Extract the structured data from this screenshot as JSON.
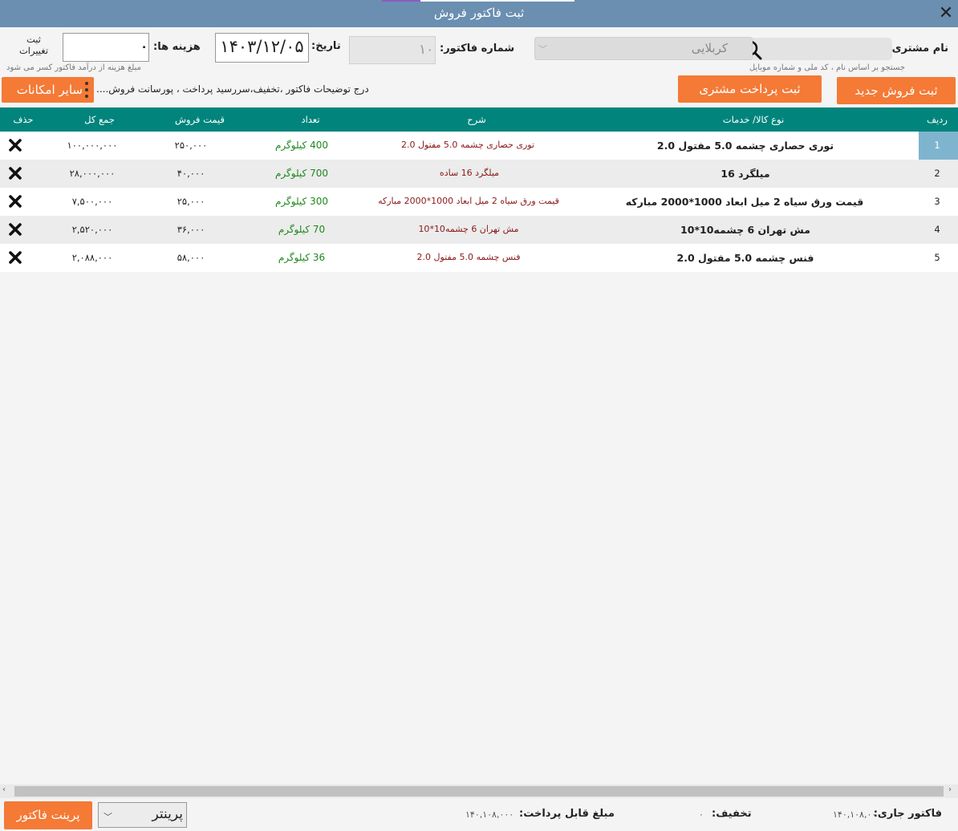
{
  "window": {
    "title": "ثبت فاکتور فروش"
  },
  "header": {
    "customer_label": "نام مشتری:",
    "search_placeholder": "",
    "search_hint": "جستجو بر اساس نام ، کد ملی و شماره موبایل",
    "customer_value": "کربلایی",
    "invoice_number_label": "شماره فاکتور:",
    "invoice_number": "۱۰",
    "date_label": "تاریخ:",
    "date": "۱۴۰۳/۱۲/۰۵",
    "expense_label": "هزینه ها:",
    "expense_value": "۰",
    "expense_hint": "مبلغ هزینه از درآمد فاکتور کسر می شود",
    "save_changes_line1": "ثبت",
    "save_changes_line2": "تغییرات"
  },
  "actions": {
    "new_sale": "ثبت فروش جدید",
    "customer_payment": "ثبت پرداخت مشتری",
    "notes": "درج توضیحات فاکتور ،تخفیف،سررسید پرداخت ، پورسانت فروش....",
    "more_options": "سایر امکانات"
  },
  "table": {
    "columns": {
      "index": "ردیف",
      "product": "نوع کالا/ خدمات",
      "description": "شرح",
      "quantity": "تعداد",
      "unit_price": "قیمت فروش",
      "total": "جمع کل",
      "delete": "حذف"
    },
    "rows": [
      {
        "index": "1",
        "product": "توری حصاری چشمه 5.0 مفتول 2.0",
        "description": "توری حصاری چشمه 5.0 مفتول 2.0",
        "quantity": "400 کیلوگرم",
        "unit_price": "۲۵۰,۰۰۰",
        "total": "۱۰۰,۰۰۰,۰۰۰"
      },
      {
        "index": "2",
        "product": "میلگرد 16",
        "description": "میلگرد 16 ساده",
        "quantity": "700 کیلوگرم",
        "unit_price": "۴۰,۰۰۰",
        "total": "۲۸,۰۰۰,۰۰۰"
      },
      {
        "index": "3",
        "product": "قیمت ورق سیاه 2 میل ابعاد 1000*2000 مبارکه",
        "description": "قیمت ورق سیاه 2 میل ابعاد 1000*2000 مبارکه",
        "quantity": "300 کیلوگرم",
        "unit_price": "۲۵,۰۰۰",
        "total": "۷,۵۰۰,۰۰۰"
      },
      {
        "index": "4",
        "product": "مش تهران 6  چشمه10*10",
        "description": "مش تهران 6  چشمه10*10",
        "quantity": "70 کیلوگرم",
        "unit_price": "۳۶,۰۰۰",
        "total": "۲,۵۲۰,۰۰۰"
      },
      {
        "index": "5",
        "product": "فنس چشمه 5.0 مفتول 2.0",
        "description": "فنس چشمه 5.0 مفتول 2.0",
        "quantity": "36 کیلوگرم",
        "unit_price": "۵۸,۰۰۰",
        "total": "۲,۰۸۸,۰۰۰"
      }
    ]
  },
  "footer": {
    "current_invoice_label": "فاکتور جاری:",
    "current_invoice_value": "۱۴۰,۱۰۸,۰۰۰",
    "discount_label": "تخفیف:",
    "discount_value": "۰",
    "payable_label": "مبلغ قابل پرداخت:",
    "payable_value": "۱۴۰,۱۰۸,۰۰۰",
    "printer_value": "پرینتر",
    "print_button": "پرینت فاکتور"
  },
  "colors": {
    "titlebar": "#6a8fb1",
    "table_header": "#00847c",
    "accent_button": "#f47a36",
    "selected_index": "#7fb4cf"
  },
  "icons": [
    "close-icon",
    "search-icon",
    "more-dots-icon",
    "delete-icon",
    "chevron-down-icon"
  ]
}
